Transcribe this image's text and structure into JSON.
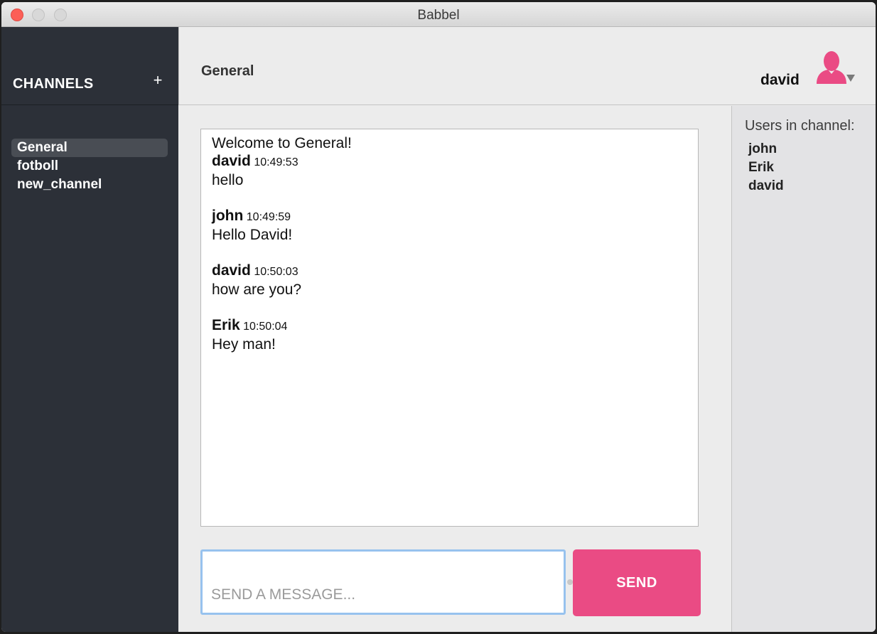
{
  "window": {
    "title": "Babbel"
  },
  "sidebar": {
    "heading": "CHANNELS",
    "add_label": "+",
    "channels": [
      {
        "label": "General",
        "active": true
      },
      {
        "label": "fotboll",
        "active": false
      },
      {
        "label": "new_channel",
        "active": false
      }
    ]
  },
  "header": {
    "channel_name": "General",
    "username": "david",
    "avatar_icon": "user-avatar-icon",
    "avatar_color": "#ea4b84"
  },
  "messages": {
    "welcome": "Welcome to General!",
    "items": [
      {
        "author": "david",
        "time": "10:49:53",
        "text": "hello"
      },
      {
        "author": "john",
        "time": "10:49:59",
        "text": "Hello David!"
      },
      {
        "author": "david",
        "time": "10:50:03",
        "text": "how are you?"
      },
      {
        "author": "Erik",
        "time": "10:50:04",
        "text": "Hey man!"
      }
    ]
  },
  "composer": {
    "placeholder": "SEND A MESSAGE...",
    "value": "",
    "send_label": "SEND",
    "send_color": "#ea4b84"
  },
  "users_panel": {
    "title": "Users in channel:",
    "users": [
      "john",
      "Erik",
      "david"
    ]
  }
}
